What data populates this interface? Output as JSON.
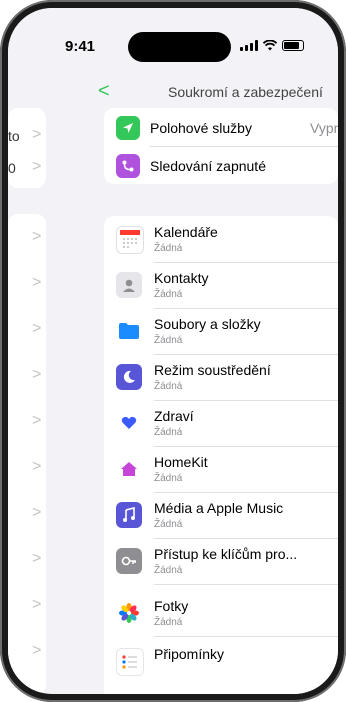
{
  "status": {
    "time": "9:41"
  },
  "nav": {
    "back_glyph": "<",
    "title": "Soukromí a zabezpečení"
  },
  "left_panel": {
    "items": [
      {
        "text": "to",
        "chevron": ">"
      },
      {
        "text": "0",
        "chevron": ">"
      }
    ]
  },
  "top_card": {
    "rows": [
      {
        "label": "Polohové služby",
        "value": "Vypnu",
        "icon": "location-arrow-icon",
        "color": "#34c759"
      },
      {
        "label": "Sledování zapnuté",
        "value": "",
        "icon": "tracking-icon",
        "color": "#af52de"
      }
    ]
  },
  "apps": [
    {
      "label": "Kalendáře",
      "sub": "Žádná",
      "icon": "calendar-icon",
      "color": "#ffffff"
    },
    {
      "label": "Kontakty",
      "sub": "Žádná",
      "icon": "contacts-icon",
      "color": "#e5e5ea"
    },
    {
      "label": "Soubory a složky",
      "sub": "Žádná",
      "icon": "folder-icon",
      "color": "#ffffff"
    },
    {
      "label": "Režim soustředění",
      "sub": "Žádná",
      "icon": "focus-icon",
      "color": "#5856d6"
    },
    {
      "label": "Zdraví",
      "sub": "Žádná",
      "icon": "health-icon",
      "color": "#ffffff"
    },
    {
      "label": "HomeKit",
      "sub": "Žádná",
      "icon": "home-icon",
      "color": "#ffffff"
    },
    {
      "label": "Média a Apple Music",
      "sub": "Žádná",
      "icon": "music-icon",
      "color": "#5856d6"
    },
    {
      "label": "Přístup ke klíčům pro...",
      "sub": "Žádná",
      "icon": "key-icon",
      "color": "#8e8e93"
    },
    {
      "label": "Fotky",
      "sub": "Žádná",
      "icon": "photos-icon",
      "color": "#ffffff"
    },
    {
      "label": "Připomínky",
      "sub": "Žádná",
      "icon": "reminders-icon",
      "color": "#ffffff"
    }
  ]
}
